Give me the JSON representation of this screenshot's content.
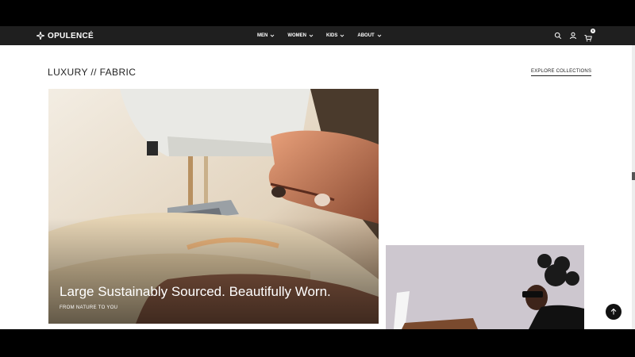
{
  "header": {
    "brand": "OPULENCÉ",
    "menu": [
      {
        "label": "MEN"
      },
      {
        "label": "WOMEN"
      },
      {
        "label": "KIDS"
      },
      {
        "label": "ABOUT"
      }
    ],
    "icons": [
      "search-icon",
      "user-icon",
      "cart-icon"
    ],
    "cart_count": "0"
  },
  "section": {
    "title": "LUXURY // FABRIC",
    "link_label": "EXPLORE COLLECTIONS"
  },
  "hero": {
    "headline": "Large Sustainably Sourced. Beautifully Worn.",
    "subtext": "FROM NATURE TO YOU"
  },
  "controls": {
    "back_to_top_icon": "arrow-up-icon"
  },
  "colors": {
    "nav_bg": "#1f1f1f",
    "page_bg": "#ffffff",
    "text": "#222222"
  }
}
